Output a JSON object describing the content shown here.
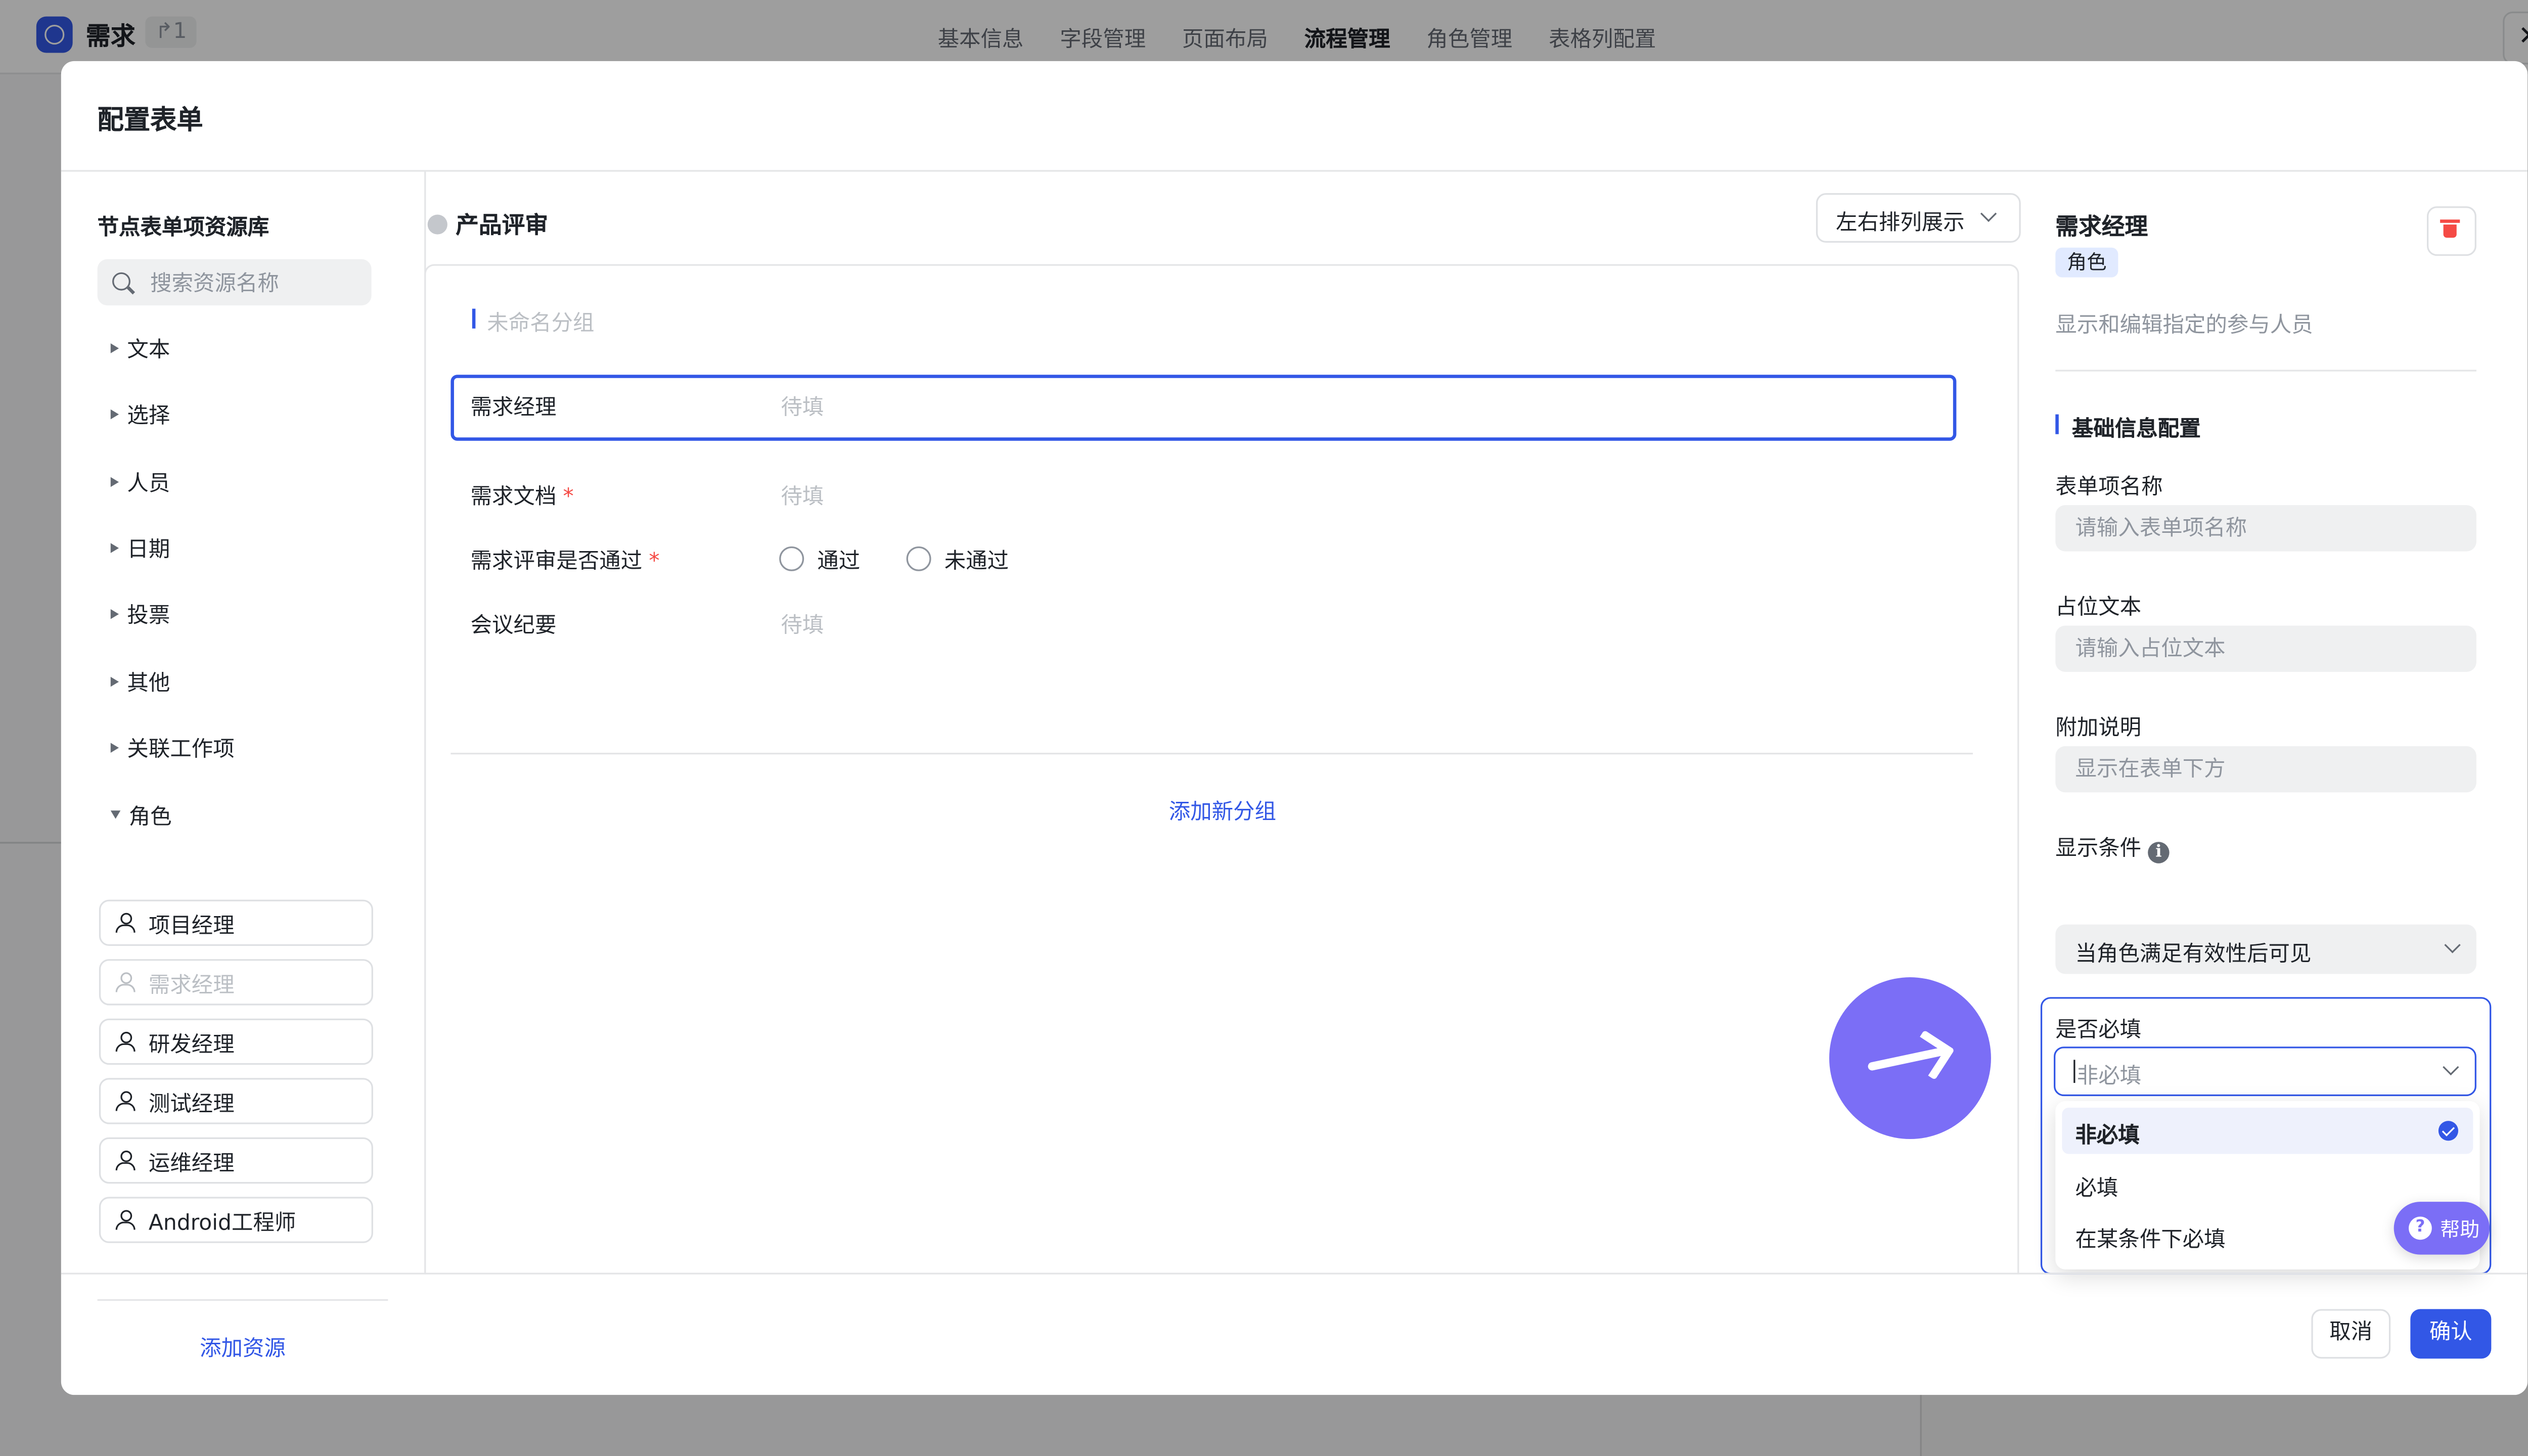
{
  "app": {
    "name": "需求",
    "count": "↱1",
    "tabs": [
      "基本信息",
      "字段管理",
      "页面布局",
      "流程管理",
      "角色管理",
      "表格列配置"
    ],
    "active_tab": "流程管理",
    "close_icon": "close-icon"
  },
  "modal": {
    "title": "配置表单",
    "library": {
      "title": "节点表单项资源库",
      "search_placeholder": "搜索资源名称",
      "categories": [
        "文本",
        "选择",
        "人员",
        "日期",
        "投票",
        "其他",
        "关联工作项",
        "角色"
      ],
      "roles": [
        "项目经理",
        "需求经理",
        "研发经理",
        "测试经理",
        "运维经理",
        "Android工程师"
      ],
      "add_resource": "添加资源"
    },
    "center": {
      "stage_title": "产品评审",
      "layout_select": "左右排列展示",
      "group_name": "未命名分组",
      "fields": [
        {
          "label": "需求经理",
          "placeholder": "待填",
          "required": false
        },
        {
          "label": "需求文档",
          "placeholder": "待填",
          "required": true
        },
        {
          "label": "需求评审是否通过",
          "required": true,
          "options": [
            "通过",
            "未通过"
          ]
        },
        {
          "label": "会议纪要",
          "placeholder": "待填",
          "required": false
        }
      ],
      "required_mark": "*",
      "add_group": "添加新分组"
    },
    "right": {
      "title": "需求经理",
      "tag": "角色",
      "desc": "显示和编辑指定的参与人员",
      "section_title": "基础信息配置",
      "name_label": "表单项名称",
      "name_placeholder": "请输入表单项名称",
      "ph_label": "占位文本",
      "ph_placeholder": "请输入占位文本",
      "note_label": "附加说明",
      "note_placeholder": "显示在表单下方",
      "cond_label": "显示条件",
      "cond_value": "当角色满足有效性后可见",
      "required_label": "是否必填",
      "required_value": "非必填",
      "required_options": [
        "非必填",
        "必填",
        "在某条件下必填"
      ],
      "selected_option": "非必填"
    },
    "help": "帮助",
    "cancel": "取消",
    "confirm": "确认"
  },
  "colors": {
    "accent": "#3257e6",
    "danger": "#f54a45",
    "fab": "#7b6ef6"
  }
}
